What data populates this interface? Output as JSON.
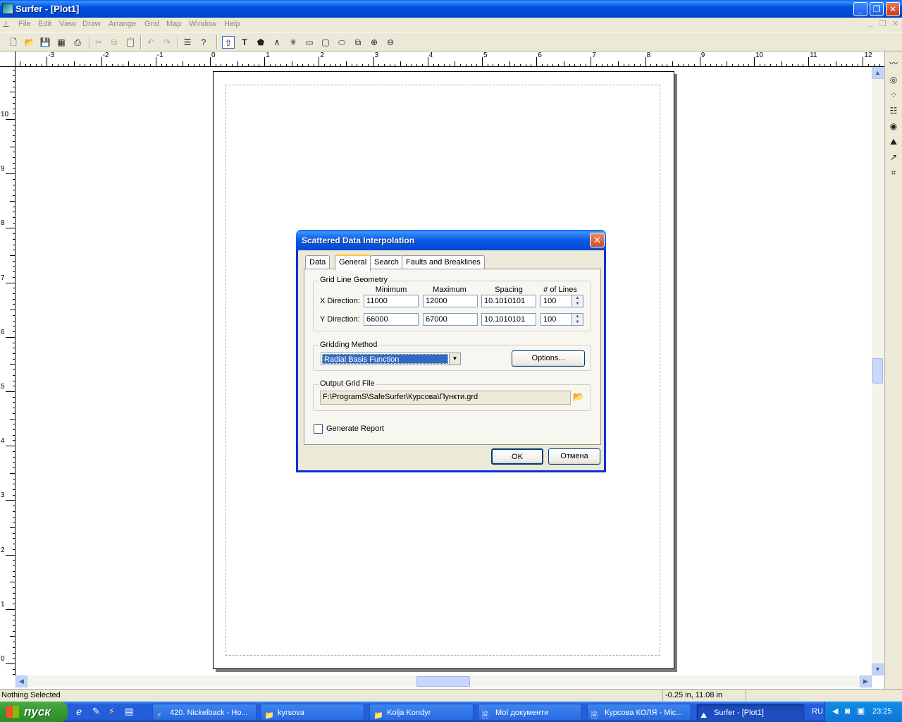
{
  "window": {
    "title": "Surfer - [Plot1]"
  },
  "menu": [
    "File",
    "Edit",
    "View",
    "Draw",
    "Arrange",
    "Grid",
    "Map",
    "Window",
    "Help"
  ],
  "ruler": {
    "h_labels": [
      "-3",
      "-2",
      "-1",
      "0",
      "1",
      "2",
      "3",
      "4",
      "5",
      "6",
      "7",
      "8",
      "9",
      "10",
      "11",
      "12"
    ],
    "v_labels": [
      "10",
      "9",
      "8",
      "7",
      "6",
      "5",
      "4",
      "3",
      "2",
      "1",
      "0"
    ]
  },
  "status": {
    "left": "Nothing Selected",
    "coords": "-0.25 in, 11.08 in"
  },
  "dialog": {
    "title": "Scattered Data Interpolation",
    "tabs": [
      "Data",
      "General",
      "Search",
      "Faults and Breaklines"
    ],
    "active_tab": "General",
    "grid_geometry": {
      "label": "Grid Line Geometry",
      "columns": [
        "Minimum",
        "Maximum",
        "Spacing",
        "# of Lines"
      ],
      "x": {
        "label": "X Direction:",
        "min": "11000",
        "max": "12000",
        "spacing": "10.1010101",
        "lines": "100"
      },
      "y": {
        "label": "Y Direction:",
        "min": "66000",
        "max": "67000",
        "spacing": "10.1010101",
        "lines": "100"
      }
    },
    "gridding": {
      "label": "Gridding Method",
      "method": "Radial Basis Function",
      "options_label": "Options..."
    },
    "output": {
      "label": "Output Grid File",
      "path": "F:\\ProgramS\\SafeSurfer\\Курсова\\Пункти.grd"
    },
    "report": {
      "label": "Generate Report",
      "checked": false
    },
    "ok_label": "OK",
    "cancel_label": "Отмена"
  },
  "taskbar": {
    "start": "пуск",
    "tasks": [
      "420. Nickelback - Ho...",
      "kyrsova",
      "Kolja Kondyr",
      "Мої документи",
      "Курсова КОЛЯ - Mic...",
      "Surfer - [Plot1]"
    ],
    "active_task": "Surfer - [Plot1]",
    "lang": "RU",
    "clock": "23:25"
  },
  "colors": {
    "accent": "#0831d9",
    "selection": "#316ac5",
    "face": "#ece9d8"
  }
}
